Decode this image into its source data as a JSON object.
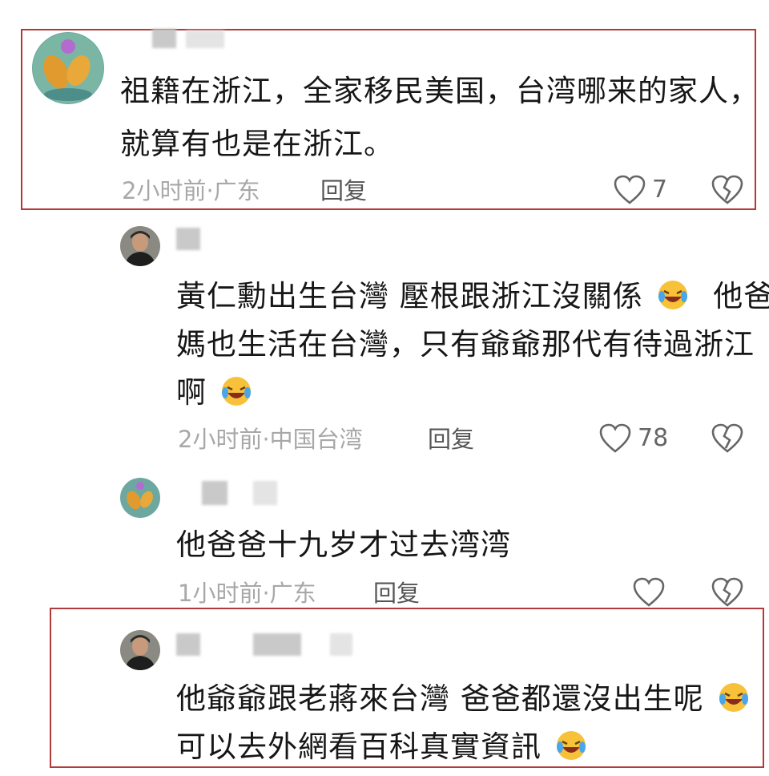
{
  "comments": [
    {
      "text_lines": [
        "祖籍在浙江，全家移民美国，台湾哪来的家人，",
        "就算有也是在浙江。"
      ],
      "time": "2小时前",
      "location": "广东",
      "reply_label": "回复",
      "likes": "7"
    },
    {
      "text_lines": [
        "黃仁勳出生台灣 壓根跟浙江沒關係",
        "他爸",
        "媽也生活在台灣，只有爺爺那代有待過浙江",
        "啊"
      ],
      "time": "2小时前",
      "location": "中国台湾",
      "reply_label": "回复",
      "likes": "78"
    },
    {
      "text_lines": [
        "他爸爸十九岁才过去湾湾"
      ],
      "time": "1小时前",
      "location": "广东",
      "reply_label": "回复",
      "likes": ""
    },
    {
      "text_lines": [
        "他爺爺跟老蔣來台灣 爸爸都還沒出生呢",
        "可以去外網看百科真實資訊"
      ]
    }
  ],
  "separator": "·",
  "colors": {
    "highlight_border": "#b23a3a",
    "meta_text": "#a8a8a8",
    "body_text": "#161616"
  },
  "icons": [
    "heart-icon",
    "broken-heart-icon",
    "laughing-crying-emoji"
  ]
}
